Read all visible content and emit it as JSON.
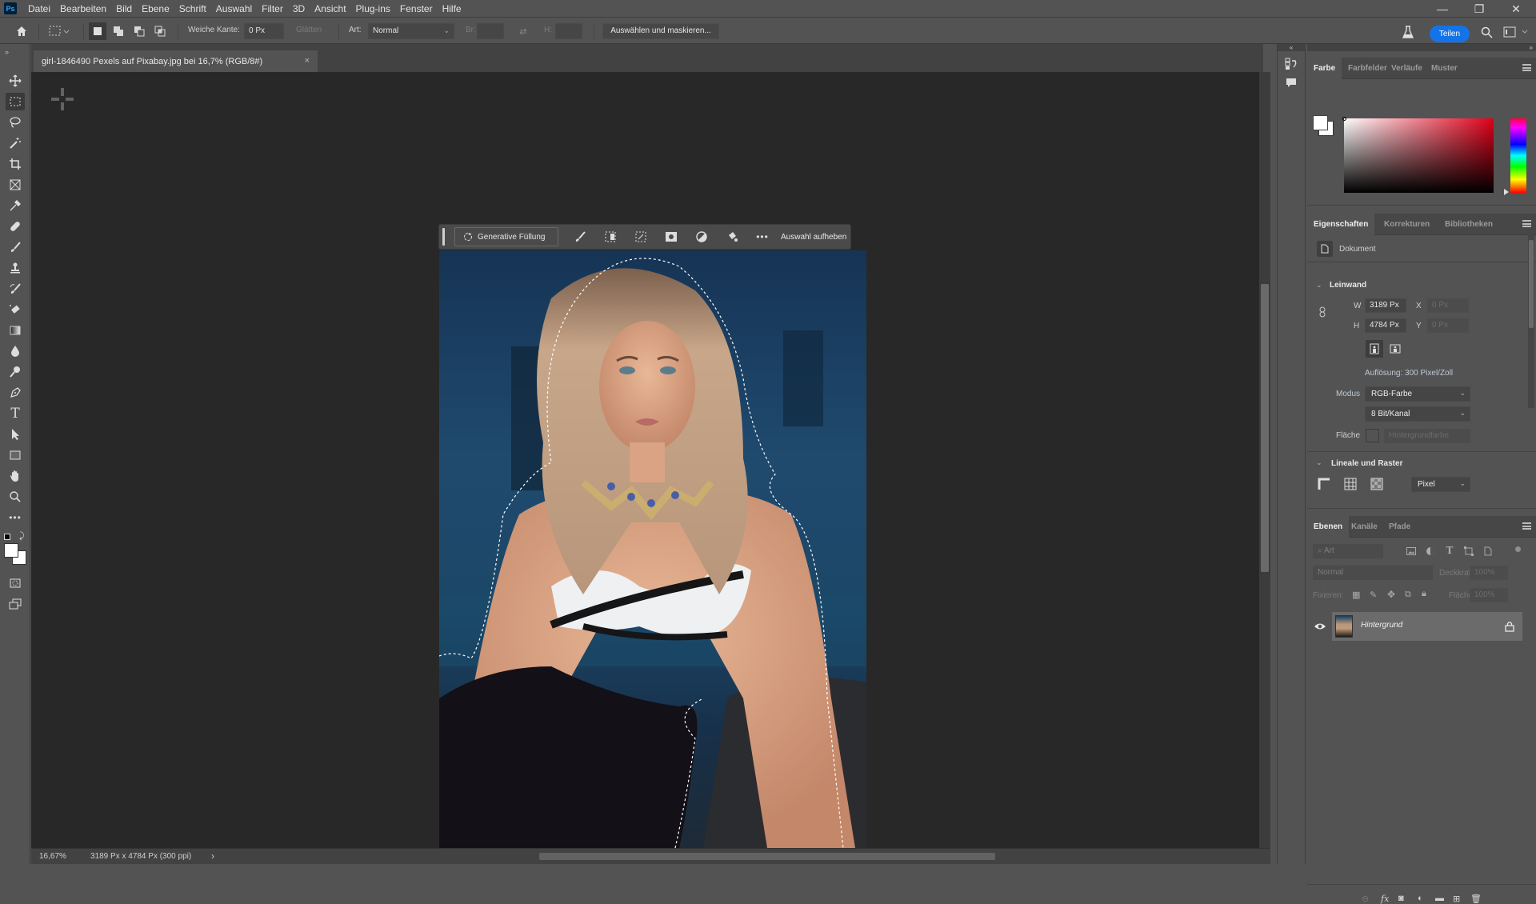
{
  "app": {
    "logo": "Ps",
    "menu": [
      "Datei",
      "Bearbeiten",
      "Bild",
      "Ebene",
      "Schrift",
      "Auswahl",
      "Filter",
      "3D",
      "Ansicht",
      "Plug-ins",
      "Fenster",
      "Hilfe"
    ],
    "window_controls": {
      "minimize": "—",
      "restore": "❐",
      "close": "✕"
    }
  },
  "options_bar": {
    "feather_label": "Weiche Kante:",
    "feather_value": "0 Px",
    "antialias_label": "Glätten",
    "style_label": "Art:",
    "style_value": "Normal",
    "width_label": "Br:",
    "height_label": "H:",
    "select_mask_label": "Auswählen und maskieren...",
    "share_label": "Teilen"
  },
  "document": {
    "tab_title": "girl-1846490 Pexels auf Pixabay.jpg bei 16,7% (RGB/8#)",
    "close": "×"
  },
  "contextual_taskbar": {
    "generative_fill_label": "Generative Füllung",
    "deselect_label": "Auswahl aufheben",
    "icons": [
      "brush-mask-icon",
      "select-subject-icon",
      "transform-selection-icon",
      "create-mask-icon",
      "invert-selection-icon",
      "fill-selection-icon",
      "more-icon"
    ]
  },
  "status_bar": {
    "zoom": "16,67%",
    "doc_info": "3189 Px x 4784 Px (300 ppi)",
    "arrow": "›"
  },
  "color_panel": {
    "tabs": [
      "Farbe",
      "Farbfelder",
      "Verläufe",
      "Muster"
    ],
    "active_tab": "Farbe",
    "foreground": "#ffffff",
    "background": "#ffffff",
    "hue_color": "#e0001a"
  },
  "properties_panel": {
    "tabs": [
      "Eigenschaften",
      "Korrekturen",
      "Bibliotheken"
    ],
    "active_tab": "Eigenschaften",
    "doc_label": "Dokument",
    "canvas_section": "Leinwand",
    "w_label": "W",
    "w_value": "3189 Px",
    "h_label": "H",
    "h_value": "4784 Px",
    "x_label": "X",
    "x_value": "0 Px",
    "y_label": "Y",
    "y_value": "0 Px",
    "resolution": "Auflösung: 300 Pixel/Zoll",
    "mode_label": "Modus",
    "mode_value": "RGB-Farbe",
    "depth_value": "8 Bit/Kanal",
    "fill_label": "Fläche",
    "fill_value": "Hintergrundfarbe",
    "rulers_section": "Lineale und Raster",
    "units_value": "Pixel"
  },
  "layers_panel": {
    "tabs": [
      "Ebenen",
      "Kanäle",
      "Pfade"
    ],
    "active_tab": "Ebenen",
    "filter_placeholder": "Art",
    "blend_mode": "Normal",
    "opacity_label": "Deckkraft:",
    "opacity_value": "100%",
    "lock_label": "Fixieren:",
    "fill_label": "Fläche:",
    "fill_value": "100%",
    "layers": [
      {
        "name": "Hintergrund",
        "visible": true,
        "locked": true
      }
    ]
  }
}
